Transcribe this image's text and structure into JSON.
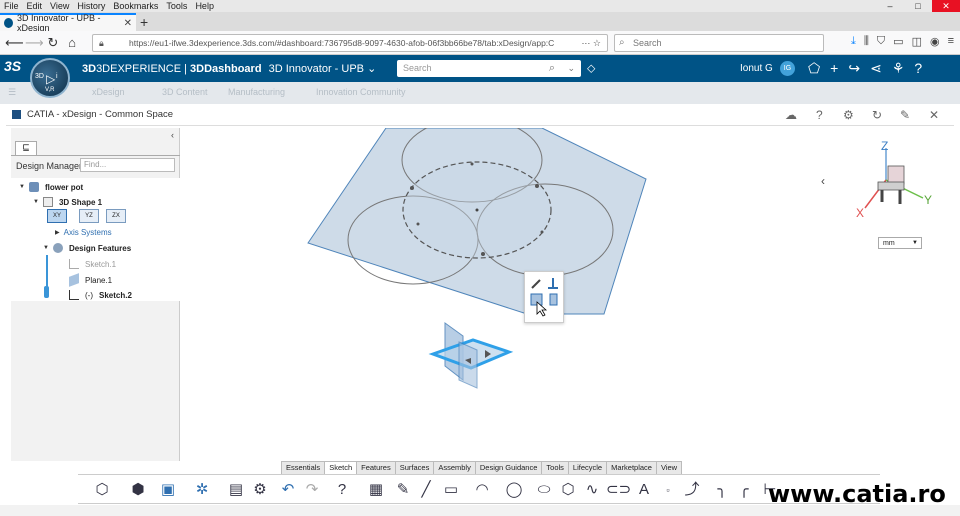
{
  "browser": {
    "menu": [
      "File",
      "Edit",
      "View",
      "History",
      "Bookmarks",
      "Tools",
      "Help"
    ],
    "tab_title": "3D Innovator - UPB - xDesign",
    "url": "https://eu1-ifwe.3dexperience.3ds.com/#dashboard:736795d8-9097-4630-afob-06f3bb66be78/tab:xDesign/app:C",
    "search_placeholder": "Search"
  },
  "dxbar": {
    "brand": "3DEXPERIENCE",
    "dashboard": "3DDashboard",
    "space": "3D Innovator - UPB",
    "search_placeholder": "Search",
    "user_name": "Ionut G",
    "user_initials": "IG",
    "compass_label": "V,R"
  },
  "dashtabs": [
    "xDesign",
    "3D Content",
    "Manufacturing",
    "Innovation Community"
  ],
  "app": {
    "title": "CATIA - xDesign - Common Space"
  },
  "tree": {
    "panel_label": "Design Manager",
    "find_placeholder": "Find...",
    "nodes": {
      "root": "flower pot",
      "shape": "3D Shape 1",
      "axis": "Axis Systems",
      "features": "Design Features",
      "sketch1": "Sketch.1",
      "plane1": "Plane.1",
      "sketch2_prefix": "(-)",
      "sketch2": "Sketch.2"
    },
    "planes": [
      "XY",
      "YZ",
      "ZX"
    ]
  },
  "viewport": {
    "units": "mm",
    "axes": {
      "x": "X",
      "y": "Y",
      "z": "Z"
    }
  },
  "action_tabs": [
    "Essentials",
    "Sketch",
    "Features",
    "Surfaces",
    "Assembly",
    "Design Guidance",
    "Tools",
    "Lifecycle",
    "Marketplace",
    "View"
  ],
  "watermark": "www.catia.ro",
  "colors": {
    "brand_blue": "#005386",
    "selection_blue": "#2fa0e8",
    "plane_fill": "#c9d8e6"
  }
}
